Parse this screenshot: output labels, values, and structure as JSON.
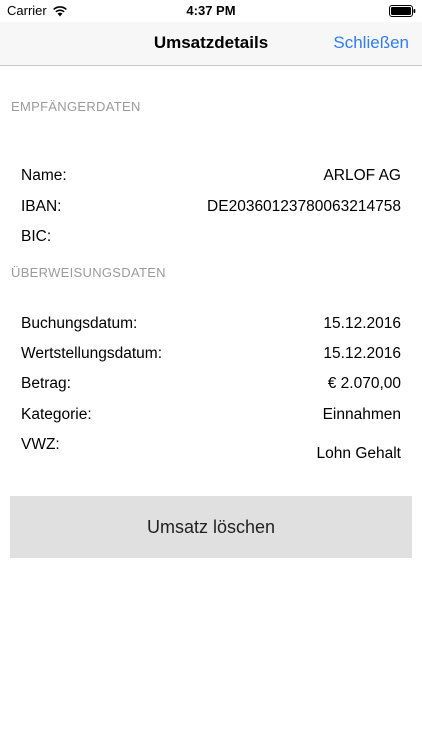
{
  "status_bar": {
    "carrier": "Carrier",
    "time": "4:37 PM"
  },
  "nav": {
    "title": "Umsatzdetails",
    "close_label": "Schließen",
    "accent_color": "#2f7cf6"
  },
  "recipient_section": {
    "header": "EMPFÄNGERDATEN",
    "rows": [
      {
        "label": "Name:",
        "value": "ARLOF AG"
      },
      {
        "label": "IBAN:",
        "value": "DE20360123780063214758"
      },
      {
        "label": "BIC:",
        "value": ""
      }
    ]
  },
  "transfer_section": {
    "header": "ÜBERWEISUNGSDATEN",
    "rows": [
      {
        "label": "Buchungsdatum:",
        "value": "15.12.2016"
      },
      {
        "label": "Wertstellungsdatum:",
        "value": "15.12.2016"
      },
      {
        "label": "Betrag:",
        "value": "€ 2.070,00"
      },
      {
        "label": "Kategorie:",
        "value": "Einnahmen"
      },
      {
        "label": "VWZ:",
        "value": "Lohn Gehalt"
      }
    ]
  },
  "actions": {
    "delete_label": "Umsatz löschen"
  }
}
